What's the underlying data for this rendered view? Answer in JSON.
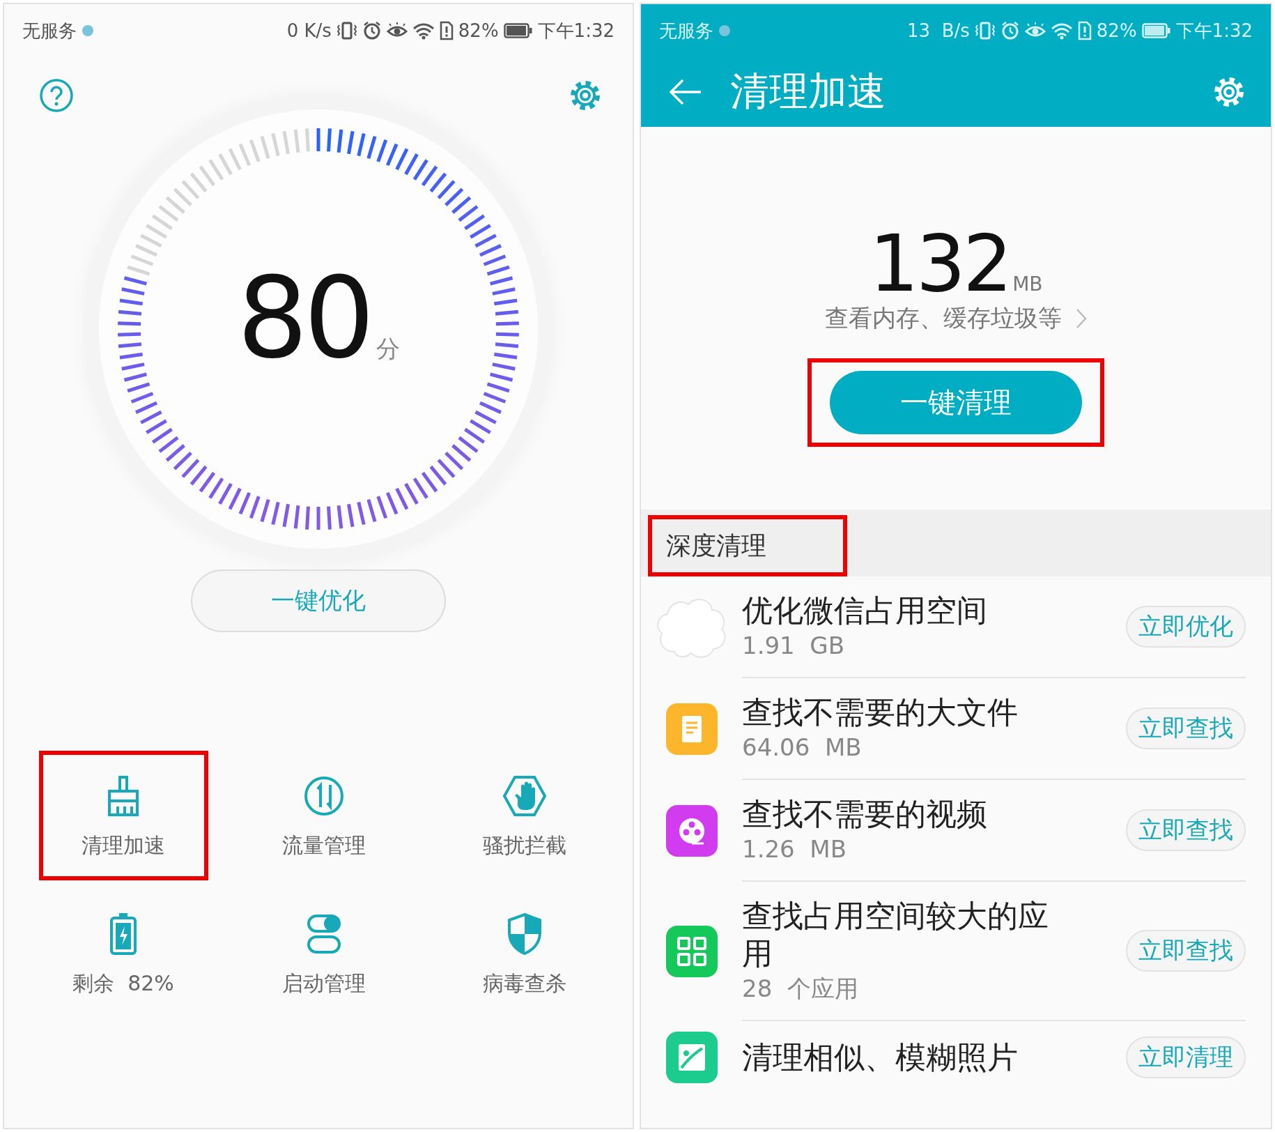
{
  "left_screen": {
    "status_bar": {
      "carrier": "无服务",
      "speed": "0 K/s",
      "battery": "82%",
      "time": "下午1:32"
    },
    "dial": {
      "score": "80",
      "unit": "分"
    },
    "optimize_button": "一键优化",
    "tools": [
      {
        "kind": "broom",
        "label": "清理加速",
        "highlighted": true
      },
      {
        "kind": "traffic",
        "label": "流量管理",
        "highlighted": false
      },
      {
        "kind": "hand",
        "label": "骚扰拦截",
        "highlighted": false
      },
      {
        "kind": "battery",
        "label": "剩余  82%",
        "highlighted": false
      },
      {
        "kind": "toggle",
        "label": "启动管理",
        "highlighted": false
      },
      {
        "kind": "shield",
        "label": "病毒查杀",
        "highlighted": false
      }
    ]
  },
  "right_screen": {
    "status_bar": {
      "carrier": "无服务",
      "speed": "13  B/s",
      "battery": "82%",
      "time": "下午1:32"
    },
    "title": "清理加速",
    "summary": {
      "amount": "132",
      "unit": "MB",
      "link": "查看内存、缓存垃圾等"
    },
    "clean_button": {
      "label": "一键清理",
      "highlighted": true
    },
    "section": {
      "title": "深度清理",
      "highlighted": true
    },
    "items": [
      {
        "kind": "cloud",
        "title": "优化微信占用空间",
        "detail": "1.91  GB",
        "action": "立即优化"
      },
      {
        "kind": "document",
        "title": "查找不需要的大文件",
        "detail": "64.06  MB",
        "action": "立即查找"
      },
      {
        "kind": "video",
        "title": "查找不需要的视频",
        "detail": "1.26  MB",
        "action": "立即查找"
      },
      {
        "kind": "apps",
        "title": "查找占用空间较大的应用",
        "detail": "28  个应用",
        "action": "立即查找"
      },
      {
        "kind": "photo",
        "title": "清理相似、模糊照片",
        "action": "立即清理"
      }
    ]
  }
}
